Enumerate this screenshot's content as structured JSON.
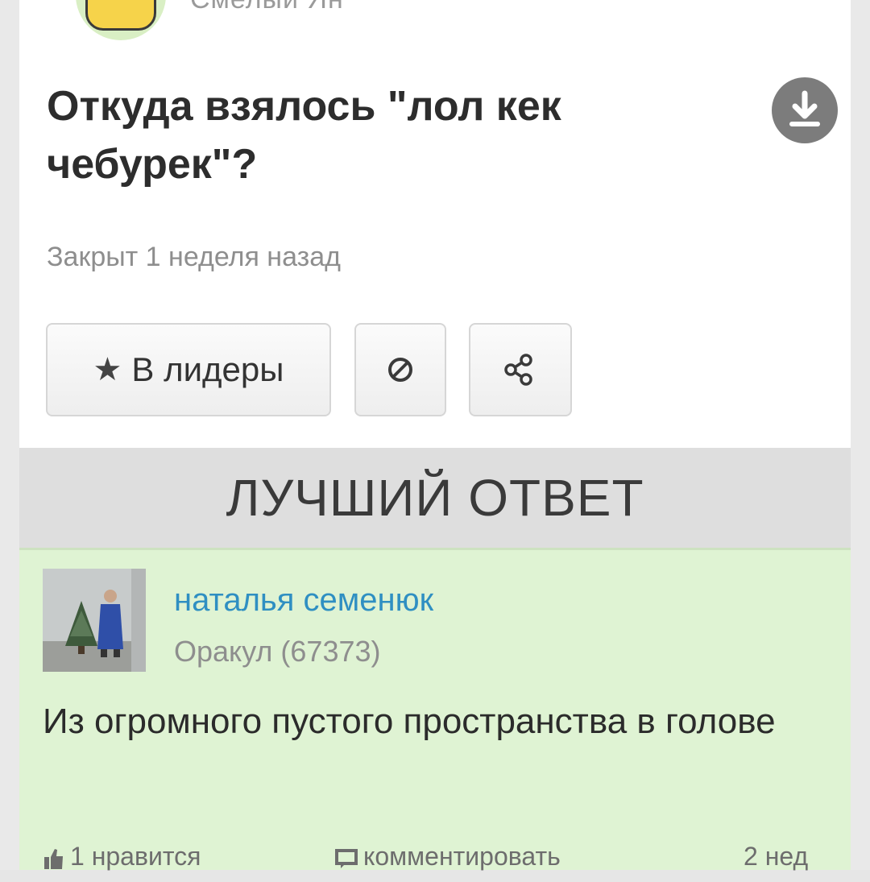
{
  "question": {
    "author": "Смелый Ян",
    "title": "Откуда взялось \"лол кек чебурек\"?",
    "status": "Закрыт 1 неделя назад",
    "buttons": {
      "leaders_label": "В лидеры"
    },
    "icons": {
      "author_avatar": "smiley-avatar",
      "download": "download-icon",
      "star": "star-icon",
      "report": "block-icon",
      "share": "share-icon"
    }
  },
  "best_answer": {
    "header": "ЛУЧШИЙ ОТВЕТ",
    "author": "наталья семенюк",
    "rank": "Оракул (67373)",
    "text": "Из огромного пустого пространства в голове",
    "footer": {
      "likes": "1 нравится",
      "comment": "комментировать",
      "time": "2 нед"
    }
  },
  "colors": {
    "answer_bg": "#dff3d3",
    "header_bg": "#dedede",
    "link_blue": "#2f8fc2"
  }
}
